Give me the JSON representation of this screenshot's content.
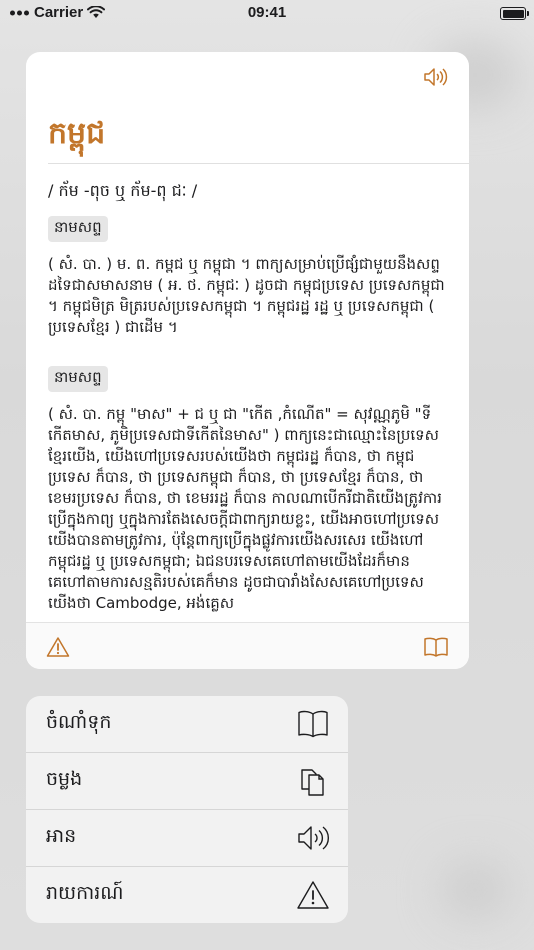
{
  "status_bar": {
    "carrier": "Carrier",
    "time": "09:41"
  },
  "card": {
    "headword": "កម្ពុជ",
    "pronunciation": "/ ក័ម -ពុច ឬ ក័ម-ពុ ជៈ /",
    "entries": [
      {
        "pos": "នាមសព្ទ",
        "definition": "( សំ. បា. ) ម. ព. កម្ពជ ឬ កម្ពុជា ។ ពាក្យសម្រាប់ប្រើផ្សំជាមួយនឹងសព្ទដទៃជាសមាសនាម ( អ. ថ. កម្ពុជៈ ) ដូចជា កម្ពុជប្រទេស ប្រទេសកម្ពុជា ។ កម្ពុជមិត្រ មិត្ររបស់ប្រទេសកម្ពុជា ។ កម្ពុជរដ្ឋ រដ្ឋ ឬ ប្រទេសកម្ពុជា ( ប្រទេសខ្មែរ ) ជាដើម ។"
      },
      {
        "pos": "នាមសព្ទ",
        "definition": "( សំ. បា. កម្ពុ \"មាស\" + ជ ឬ ជា \"កើត ,កំណើត\" = សុវណ្ណភូមិ \"ទីកើតមាស, ភូមិប្រទេសជាទីកើតនៃមាស\" ) ពាក្យនេះជាឈ្មោះនៃប្រទេសខ្មែរយើង, យើងហៅប្រទេសរបស់យើងថា កម្ពុជរដ្ឋ ក៏បាន, ថា កម្ពុជប្រទេស ក៏បាន, ថា ប្រទេសកម្ពុជា ក៏បាន, ថា ប្រទេសខ្មែរ ក៏បាន, ថា ខេមរប្រទេស ក៏បាន, ថា ខេមររដ្ឋ ក៏បាន កាលណាបើករីជាតិយើងត្រូវការប្រើក្នុងកាព្យ ឬក្នុងការតែងសេចក្ដីជាពាក្យរាយខ្លះ, យើងអាចហៅប្រទេសយើងបានតាមត្រូវការ, ប៉ុន្តែពាក្យប្រើក្នុងផ្លូវការយើងសរសេរ យើងហៅ កម្ពុជរដ្ឋ ឬ ប្រទេសកម្ពុជា; ឯជនបរទេសគេហៅតាមយើងដែរក៏មាន គេហៅតាមការសន្មតិរបស់គេក៏មាន ដូចជាបារាំងសែសគេហៅប្រទេសយើងថា Cambodge, អង់គ្លេស"
      }
    ],
    "icons": {
      "speaker": "speaker-icon",
      "warning": "warning-icon",
      "book": "book-icon"
    }
  },
  "menu": {
    "items": [
      {
        "label": "ចំណាំទុក",
        "icon": "book-icon"
      },
      {
        "label": "ចម្លង",
        "icon": "copy-icon"
      },
      {
        "label": "អាន",
        "icon": "speaker-icon"
      },
      {
        "label": "រាយការណ៍",
        "icon": "warning-icon"
      }
    ]
  },
  "colors": {
    "accent": "#c2762b",
    "text": "#1c1c1e",
    "badge_bg": "#e6e6e6"
  }
}
